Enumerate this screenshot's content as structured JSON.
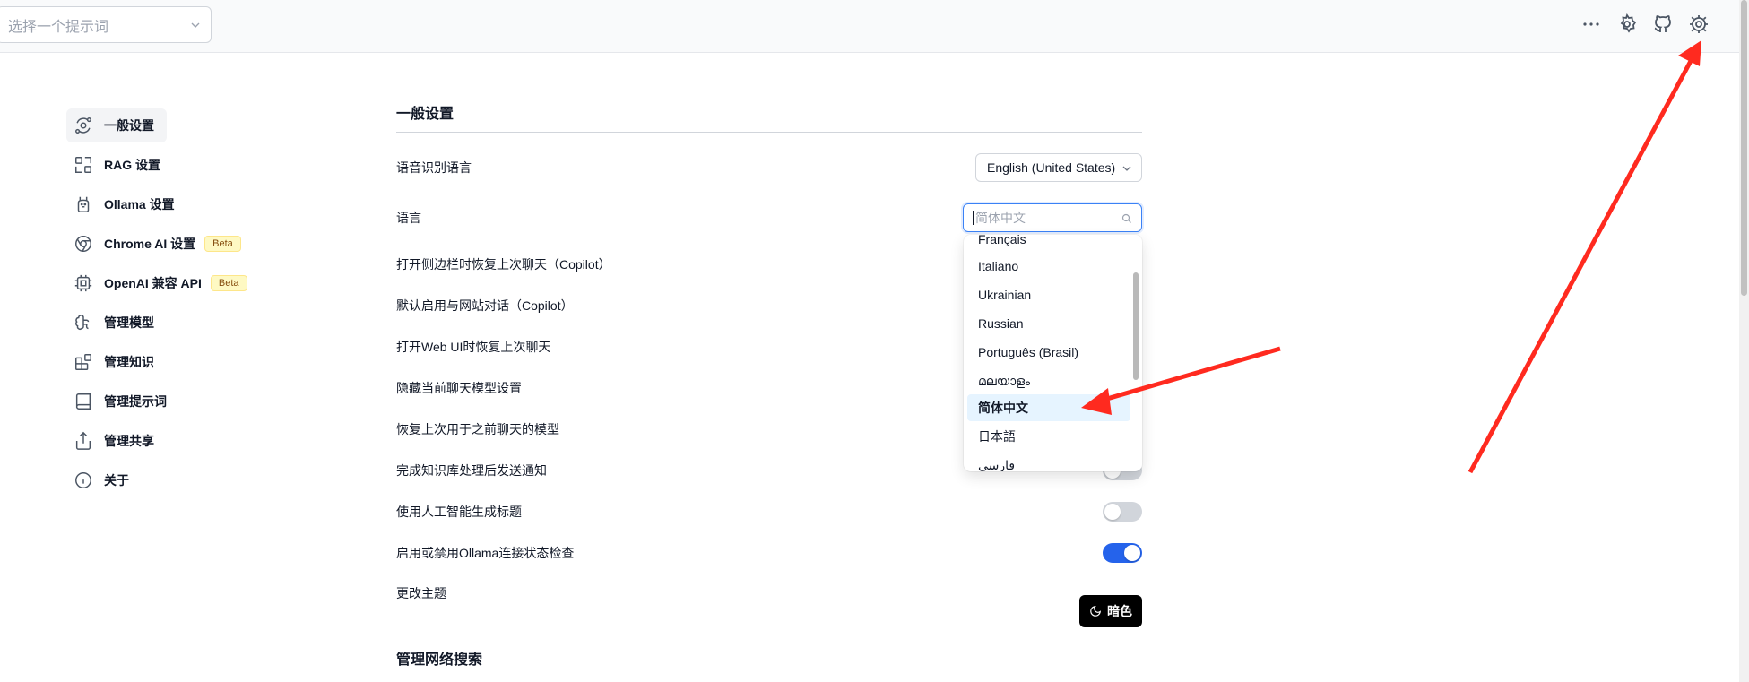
{
  "topbar": {
    "prompt_select_placeholder": "选择一个提示词",
    "icons": [
      "more-icon",
      "ollama-settings-icon",
      "github-icon",
      "settings-icon"
    ]
  },
  "sidebar": {
    "items": [
      {
        "label": "一般设置",
        "icon": "orbit-icon",
        "active": true
      },
      {
        "label": "RAG 设置",
        "icon": "scan-icon"
      },
      {
        "label": "Ollama 设置",
        "icon": "llama-icon"
      },
      {
        "label": "Chrome AI 设置",
        "icon": "chrome-icon",
        "badge": "Beta"
      },
      {
        "label": "OpenAI 兼容 API",
        "icon": "cpu-icon",
        "badge": "Beta"
      },
      {
        "label": "管理模型",
        "icon": "brain-icon"
      },
      {
        "label": "管理知识",
        "icon": "blocks-icon"
      },
      {
        "label": "管理提示词",
        "icon": "book-icon"
      },
      {
        "label": "管理共享",
        "icon": "share-icon"
      },
      {
        "label": "关于",
        "icon": "info-icon"
      }
    ]
  },
  "main": {
    "section_title": "一般设置",
    "speech_lang_label": "语音识别语言",
    "speech_lang_value": "English (United States)",
    "language_label": "语言",
    "language_placeholder": "简体中文",
    "rows": [
      "打开侧边栏时恢复上次聊天（Copilot）",
      "默认启用与网站对话（Copilot）",
      "打开Web UI时恢复上次聊天",
      "隐藏当前聊天模型设置",
      "恢复上次用于之前聊天的模型",
      "完成知识库处理后发送通知",
      "使用人工智能生成标题",
      "启用或禁用Ollama连接状态检查"
    ],
    "toggle_states": [
      false,
      false,
      false,
      false,
      false,
      false,
      false,
      true
    ],
    "theme_label": "更改主题",
    "theme_button": "暗色",
    "next_section_title": "管理网络搜索"
  },
  "language_dropdown": {
    "items": [
      "Français",
      "Italiano",
      "Ukrainian",
      "Russian",
      "Português (Brasil)",
      "മലയാളം",
      "简体中文",
      "日本語",
      "فارسی"
    ],
    "selected": "简体中文"
  },
  "annotation_color": "#ff2a1f"
}
